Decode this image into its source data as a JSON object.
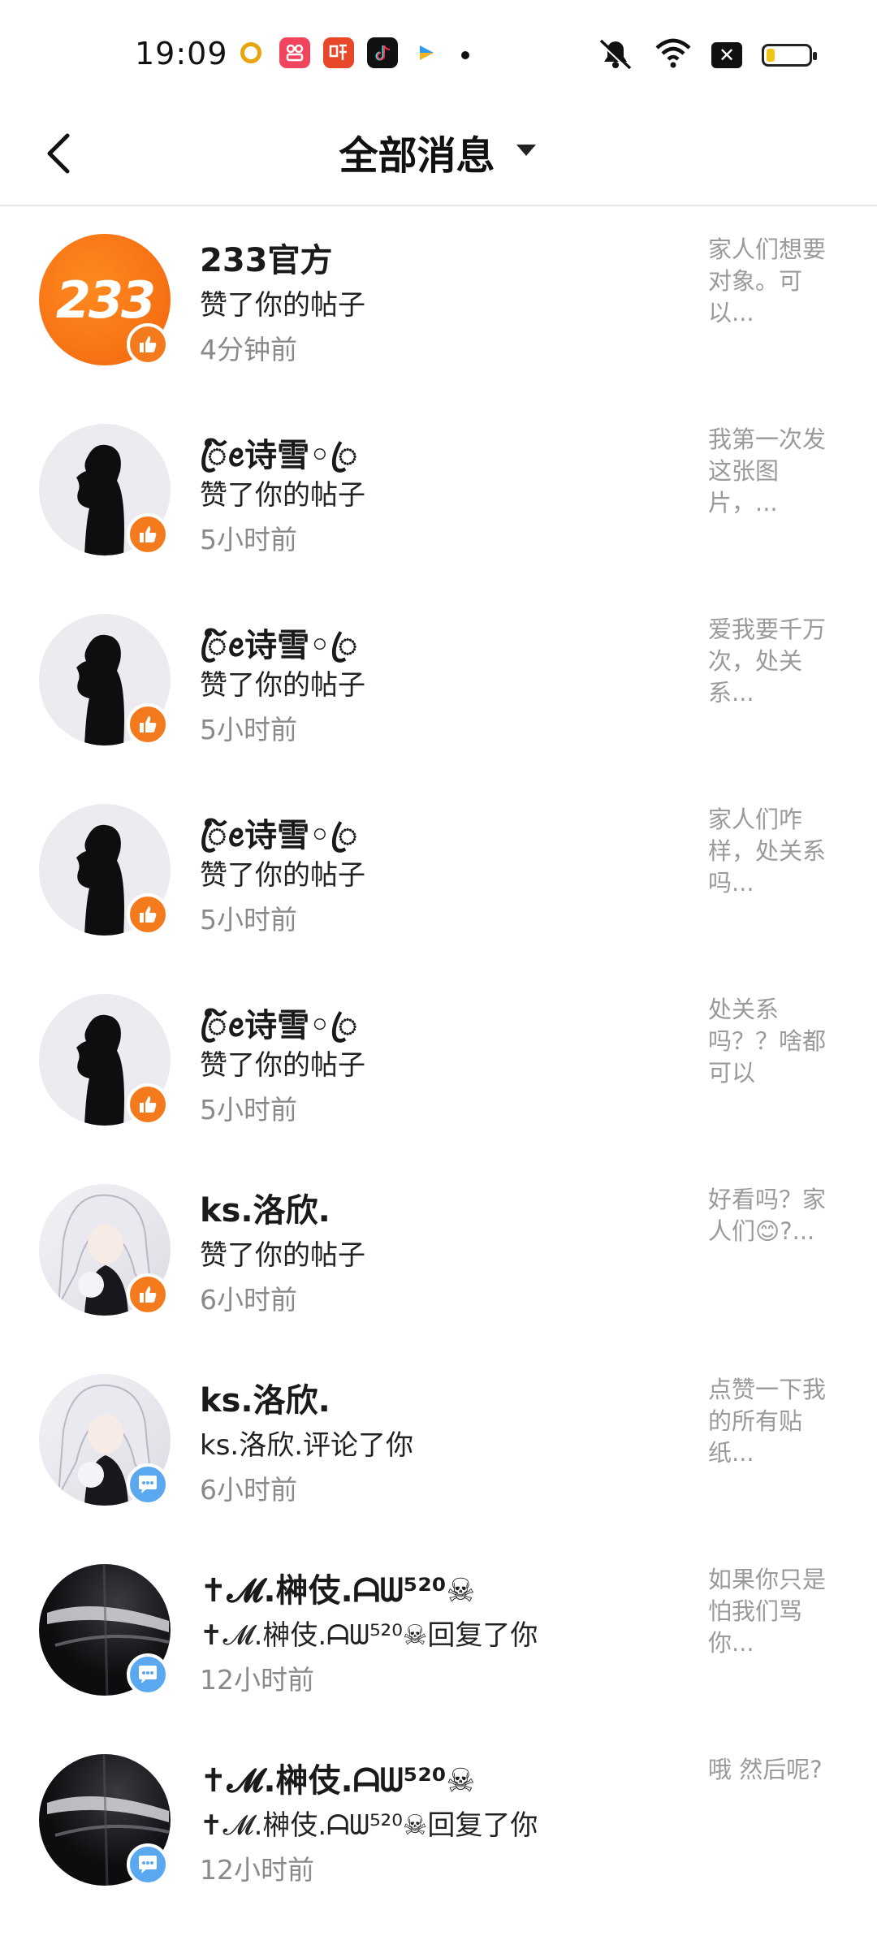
{
  "status_bar": {
    "time": "19:09",
    "notification_icons": [
      "qq-browser-icon",
      "xiaohongshu-icon",
      "ting-icon",
      "tiktok-icon",
      "video-player-icon"
    ],
    "battery_level": 0.2
  },
  "header": {
    "title": "全部消息"
  },
  "messages": [
    {
      "name": "233官方",
      "action": "赞了你的帖子",
      "time": "4分钟前",
      "preview": "家人们想要对象。可以...",
      "type": "like",
      "avatar": "233"
    },
    {
      "name": "ꦿ໌ꫀ诗雪◦ꦿ",
      "action": "赞了你的帖子",
      "time": "5小时前",
      "preview": "我第一次发这张图片，...",
      "type": "like",
      "avatar": "silhouette"
    },
    {
      "name": "ꦿ໌ꫀ诗雪◦ꦿ",
      "action": "赞了你的帖子",
      "time": "5小时前",
      "preview": "爱我要千万次，处关系...",
      "type": "like",
      "avatar": "silhouette"
    },
    {
      "name": "ꦿ໌ꫀ诗雪◦ꦿ",
      "action": "赞了你的帖子",
      "time": "5小时前",
      "preview": "家人们咋样，处关系吗...",
      "type": "like",
      "avatar": "silhouette"
    },
    {
      "name": "ꦿ໌ꫀ诗雪◦ꦿ",
      "action": "赞了你的帖子",
      "time": "5小时前",
      "preview": "处关系吗？？啥都可以",
      "type": "like",
      "avatar": "silhouette"
    },
    {
      "name": "ks.洛欣.",
      "action": "赞了你的帖子",
      "time": "6小时前",
      "preview": "好看吗？家人们😊?...",
      "type": "like",
      "avatar": "anime"
    },
    {
      "name": "ks.洛欣.",
      "action": "ks.洛欣.评论了你",
      "time": "6小时前",
      "preview": "点赞一下我的所有贴纸...",
      "type": "comment",
      "avatar": "anime"
    },
    {
      "name": "✝𝓜.榊伎.ᗩᗯ⁵²⁰☠",
      "action": "✝𝓜.榊伎.ᗩᗯ⁵²⁰☠回复了你",
      "time": "12小时前",
      "preview": "如果你只是怕我们骂你...",
      "type": "comment",
      "avatar": "dark"
    },
    {
      "name": "✝𝓜.榊伎.ᗩᗯ⁵²⁰☠",
      "action": "✝𝓜.榊伎.ᗩᗯ⁵²⁰☠回复了你",
      "time": "12小时前",
      "preview": "哦 然后呢?",
      "type": "comment",
      "avatar": "dark"
    }
  ]
}
